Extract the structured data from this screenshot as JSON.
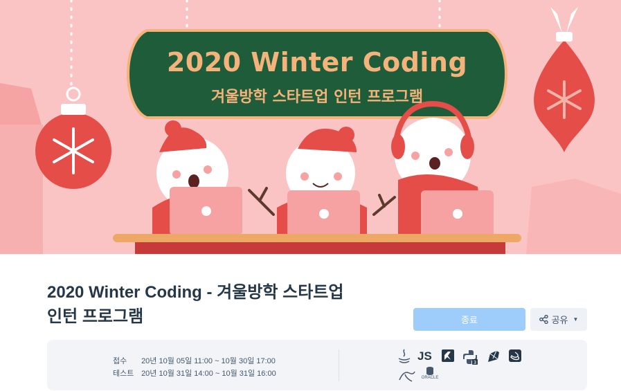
{
  "banner": {
    "title": "2020 Winter Coding",
    "subtitle": "겨울방학 스타트업 인턴 프로그램"
  },
  "page": {
    "title_line1": "2020 Winter Coding - 겨울방학 스타트업",
    "title_line2": "인턴 프로그램"
  },
  "actions": {
    "end_label": "종료",
    "share_label": "공유"
  },
  "schedule": {
    "apply_label": "접수",
    "apply_value": "20년 10월 05일 11:00 ~ 10월 30일 17:00",
    "test_label": "테스트",
    "test_value": "20년 10월 31일 14:00 ~ 10월 31일 16:00"
  },
  "languages": {
    "js_text": "JS",
    "oracle_text": "ORACLE",
    "icons": [
      "java-icon",
      "javascript-icon",
      "kotlin-icon",
      "python3-icon",
      "ruby-icon",
      "swift-icon",
      "mysql-icon",
      "oracle-icon"
    ]
  },
  "colors": {
    "banner_bg": "#fbc4c4",
    "sign_green": "#1f5c3a",
    "sign_text": "#f4b37a",
    "ornament_red": "#e44d48",
    "end_button": "#9fcdfb",
    "title_text": "#263747"
  }
}
